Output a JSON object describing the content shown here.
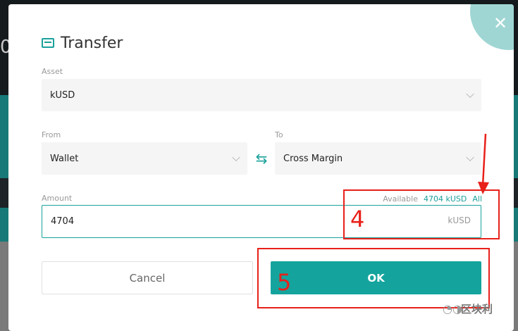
{
  "background": {
    "partial_text": "0"
  },
  "dialog": {
    "title": "Transfer",
    "asset": {
      "label": "Asset",
      "value": "kUSD"
    },
    "from": {
      "label": "From",
      "value": "Wallet"
    },
    "to": {
      "label": "To",
      "value": "Cross Margin"
    },
    "amount": {
      "label": "Amount",
      "value": "4704",
      "unit": "kUSD",
      "available_label": "Available",
      "available_value": "4704 kUSD",
      "all_label": "All"
    },
    "buttons": {
      "cancel": "Cancel",
      "ok": "OK"
    }
  },
  "annotations": {
    "step4": "4",
    "step5": "5",
    "color": "#e8201a"
  },
  "watermark": {
    "text": "区块利"
  },
  "colors": {
    "accent": "#14a49d",
    "close_corner": "#9fd6d3"
  }
}
